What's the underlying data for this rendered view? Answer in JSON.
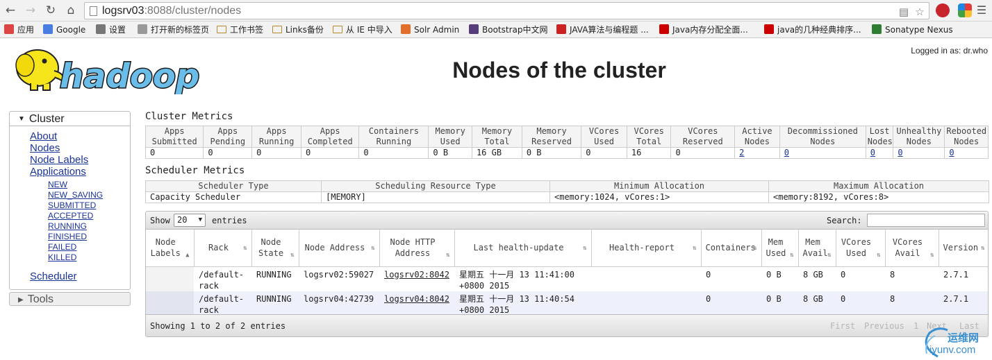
{
  "browser": {
    "url_host": "logsrv03",
    "url_rest": ":8088/cluster/nodes",
    "bookmarks": [
      {
        "label": "应用",
        "icon": "apps-grid-icon",
        "color": "#d44"
      },
      {
        "label": "Google",
        "icon": "google-icon",
        "color": "#4a7de0"
      },
      {
        "label": "设置",
        "icon": "gear-icon",
        "color": "#777"
      },
      {
        "label": "打开新的标签页",
        "icon": "page-icon",
        "color": "#999"
      },
      {
        "label": "工作书签",
        "icon": "folder-icon",
        "color": "#b88a2c"
      },
      {
        "label": "Links备份",
        "icon": "folder-icon",
        "color": "#b88a2c"
      },
      {
        "label": "从 IE 中导入",
        "icon": "folder-icon",
        "color": "#b88a2c"
      },
      {
        "label": "Solr Admin",
        "icon": "solr-icon",
        "color": "#e36d2a"
      },
      {
        "label": "Bootstrap中文网",
        "icon": "bootstrap-icon",
        "color": "#563d7c"
      },
      {
        "label": "JAVA算法与编程题 ...",
        "icon": "paw-icon",
        "color": "#c22"
      },
      {
        "label": "Java内存分配全面...",
        "icon": "csdn-icon",
        "color": "#c00"
      },
      {
        "label": "java的几种经典排序...",
        "icon": "csdn-icon",
        "color": "#c00"
      },
      {
        "label": "Sonatype Nexus",
        "icon": "nexus-icon",
        "color": "#2e7d32"
      }
    ]
  },
  "header": {
    "logo_text": "hadoop",
    "logged_in": "Logged in as: dr.who",
    "title": "Nodes of the cluster"
  },
  "nav": {
    "cluster_label": "Cluster",
    "items": [
      "About",
      "Nodes",
      "Node Labels",
      "Applications"
    ],
    "app_states": [
      "NEW",
      "NEW_SAVING",
      "SUBMITTED",
      "ACCEPTED",
      "RUNNING",
      "FINISHED",
      "FAILED",
      "KILLED"
    ],
    "scheduler": "Scheduler",
    "tools_label": "Tools"
  },
  "cluster_metrics": {
    "title": "Cluster Metrics",
    "headers": [
      [
        "Apps",
        "Submitted"
      ],
      [
        "Apps",
        "Pending"
      ],
      [
        "Apps",
        "Running"
      ],
      [
        "Apps",
        "Completed"
      ],
      [
        "Containers",
        "Running"
      ],
      [
        "Memory",
        "Used"
      ],
      [
        "Memory",
        "Total"
      ],
      [
        "Memory",
        "Reserved"
      ],
      [
        "VCores",
        "Used"
      ],
      [
        "VCores",
        "Total"
      ],
      [
        "VCores",
        "Reserved"
      ],
      [
        "Active",
        "Nodes"
      ],
      [
        "Decommissioned",
        "Nodes"
      ],
      [
        "Lost",
        "Nodes"
      ],
      [
        "Unhealthy",
        "Nodes"
      ],
      [
        "Rebooted",
        "Nodes"
      ]
    ],
    "values": [
      "0",
      "0",
      "0",
      "0",
      "0",
      "0 B",
      "16 GB",
      "0 B",
      "0",
      "16",
      "0",
      "2",
      "0",
      "0",
      "0",
      "0"
    ]
  },
  "scheduler_metrics": {
    "title": "Scheduler Metrics",
    "headers": [
      "Scheduler Type",
      "Scheduling Resource Type",
      "Minimum Allocation",
      "Maximum Allocation"
    ],
    "values": [
      "Capacity Scheduler",
      "[MEMORY]",
      "<memory:1024, vCores:1>",
      "<memory:8192, vCores:8>"
    ]
  },
  "nodes_table": {
    "show_label": "Show",
    "page_size": "20",
    "entries_label": "entries",
    "search_label": "Search:",
    "columns": [
      [
        "Node",
        "Labels"
      ],
      [
        "Rack"
      ],
      [
        "Node",
        "State"
      ],
      [
        "Node Address"
      ],
      [
        "Node HTTP",
        "Address"
      ],
      [
        "Last health-update"
      ],
      [
        "Health-report"
      ],
      [
        "Containers"
      ],
      [
        "Mem",
        "Used"
      ],
      [
        "Mem",
        "Avail"
      ],
      [
        "VCores",
        "Used"
      ],
      [
        "VCores",
        "Avail"
      ],
      [
        "Version"
      ]
    ],
    "rows": [
      {
        "labels": "",
        "rack": "/default-rack",
        "state": "RUNNING",
        "address": "logsrv02:59027",
        "http": "logsrv02:8042",
        "health_update": "星期五 十一月 13 11:41:00 +0800 2015",
        "health_report": "",
        "containers": "0",
        "mem_used": "0 B",
        "mem_avail": "8 GB",
        "vcores_used": "0",
        "vcores_avail": "8",
        "version": "2.7.1"
      },
      {
        "labels": "",
        "rack": "/default-rack",
        "state": "RUNNING",
        "address": "logsrv04:42739",
        "http": "logsrv04:8042",
        "health_update": "星期五 十一月 13 11:40:54 +0800 2015",
        "health_report": "",
        "containers": "0",
        "mem_used": "0 B",
        "mem_avail": "8 GB",
        "vcores_used": "0",
        "vcores_avail": "8",
        "version": "2.7.1"
      }
    ],
    "showing": "Showing 1 to 2 of 2 entries",
    "pager": [
      "First",
      "Previous",
      "1",
      "Next",
      "Last"
    ]
  },
  "watermark": {
    "line1": "运维网",
    "line2": "iyunv.com"
  }
}
